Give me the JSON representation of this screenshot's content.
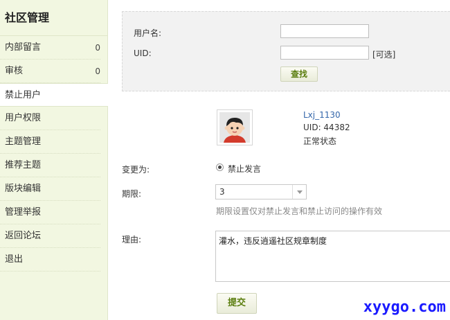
{
  "sidebar": {
    "title": "社区管理",
    "items": [
      {
        "label": "内部留言",
        "count": "0"
      },
      {
        "label": "审核",
        "count": "0"
      },
      {
        "label": "禁止用户"
      },
      {
        "label": "用户权限"
      },
      {
        "label": "主题管理"
      },
      {
        "label": "推荐主题"
      },
      {
        "label": "版块编辑"
      },
      {
        "label": "管理举报"
      },
      {
        "label": "返回论坛"
      },
      {
        "label": "退出"
      }
    ],
    "active_index": 2
  },
  "search": {
    "username_label": "用户名:",
    "username_value": "",
    "uid_label": "UID:",
    "uid_value": "",
    "optional_note": "[可选]",
    "search_button": "查找"
  },
  "user": {
    "name": "Lxj_1130",
    "uid": "UID: 44382",
    "status": "正常状态"
  },
  "form": {
    "change_to_label": "变更为:",
    "option_label": "禁止发言",
    "period_label": "期限:",
    "period_value": "3",
    "period_hint": "期限设置仅对禁止发言和禁止访问的操作有效",
    "reason_label": "理由:",
    "reason_value": "灌水，违反逍遥社区规章制度",
    "submit_button": "提交"
  },
  "watermark": "xyygo.com",
  "colors": {
    "sidebar_bg": "#f2f7e1",
    "button_text": "#5a7d0e",
    "link": "#3366aa",
    "watermark": "#1a1aff"
  }
}
